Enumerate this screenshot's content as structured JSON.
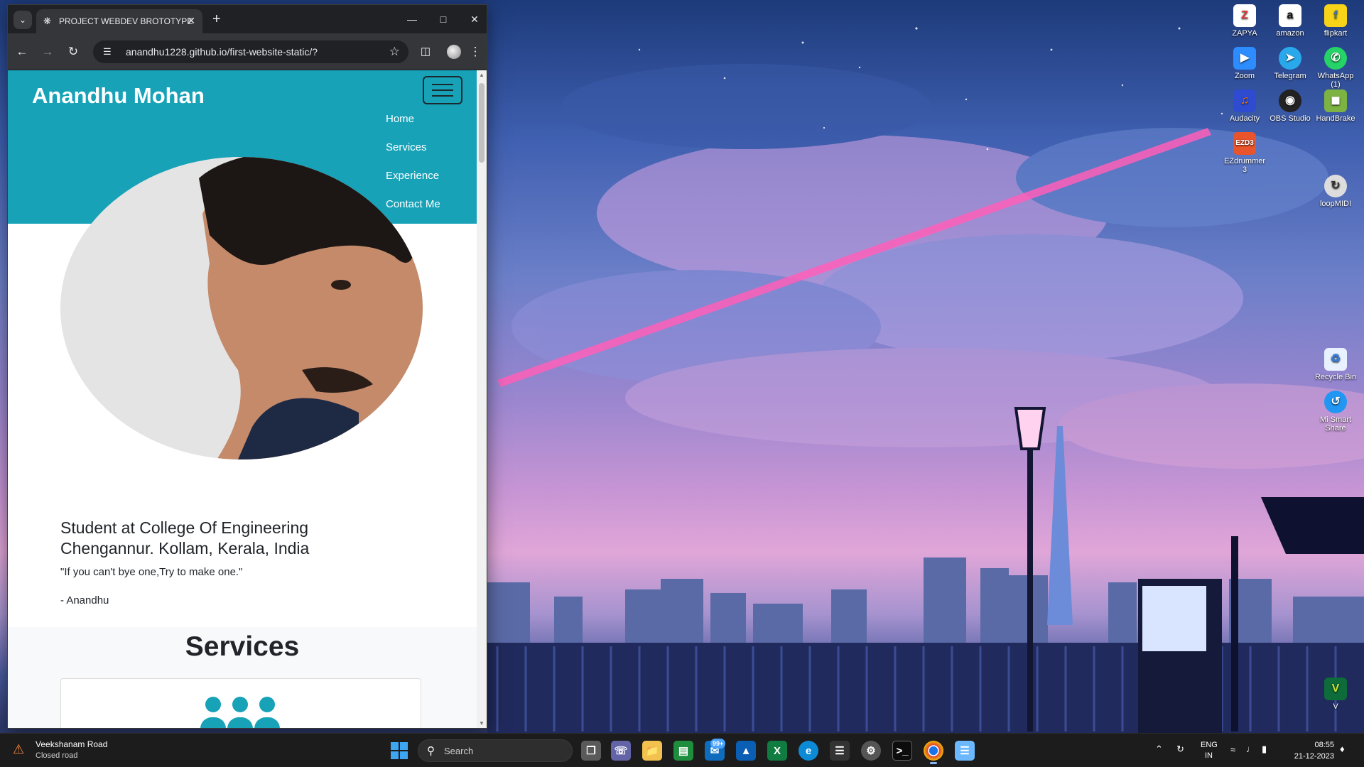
{
  "browser": {
    "tab_title": "PROJECT WEBDEV BROTOTYPE",
    "url": "anandhu1228.github.io/first-website-static/?"
  },
  "site": {
    "brand": "Anandhu Mohan",
    "nav_items": [
      "Home",
      "Services",
      "Experience",
      "Contact Me"
    ],
    "about_heading": "Student at College Of Engineering Chengannur. Kollam, Kerala, India",
    "quote": "\"If you can't bye one,Try to make one.\"",
    "signature": "- Anandhu",
    "services_title": "Services"
  },
  "desktop_icons": [
    {
      "label": "ZAPYA",
      "icon": "zapya-icon"
    },
    {
      "label": "amazon",
      "icon": "amazon-icon"
    },
    {
      "label": "flipkart",
      "icon": "flipkart-icon"
    },
    {
      "label": "Zoom",
      "icon": "zoom-icon"
    },
    {
      "label": "Telegram",
      "icon": "telegram-icon"
    },
    {
      "label": "WhatsApp (1)",
      "icon": "whatsapp-icon"
    },
    {
      "label": "Audacity",
      "icon": "audacity-icon"
    },
    {
      "label": "OBS Studio",
      "icon": "obs-icon"
    },
    {
      "label": "HandBrake",
      "icon": "handbrake-icon"
    },
    {
      "label": "EZdrummer 3",
      "icon": "ezdrummer-icon"
    },
    {
      "label": "loopMIDI",
      "icon": "loopmidi-icon"
    },
    {
      "label": "Recycle Bin",
      "icon": "recycle-bin-icon"
    },
    {
      "label": "Mi Smart Share",
      "icon": "mi-share-icon"
    },
    {
      "label": "V",
      "icon": "v-app-icon"
    }
  ],
  "taskbar": {
    "weather_title": "Veekshanam Road",
    "weather_sub": "Closed road",
    "search_label": "Search",
    "mail_badge": "99+",
    "lang_1": "ENG",
    "lang_2": "IN",
    "time": "08:55",
    "date": "21-12-2023"
  },
  "colors": {
    "nav_bg": "#17a2b8",
    "service_icon": "#17a2b8",
    "taskbar_bg": "#1c1c1c"
  }
}
